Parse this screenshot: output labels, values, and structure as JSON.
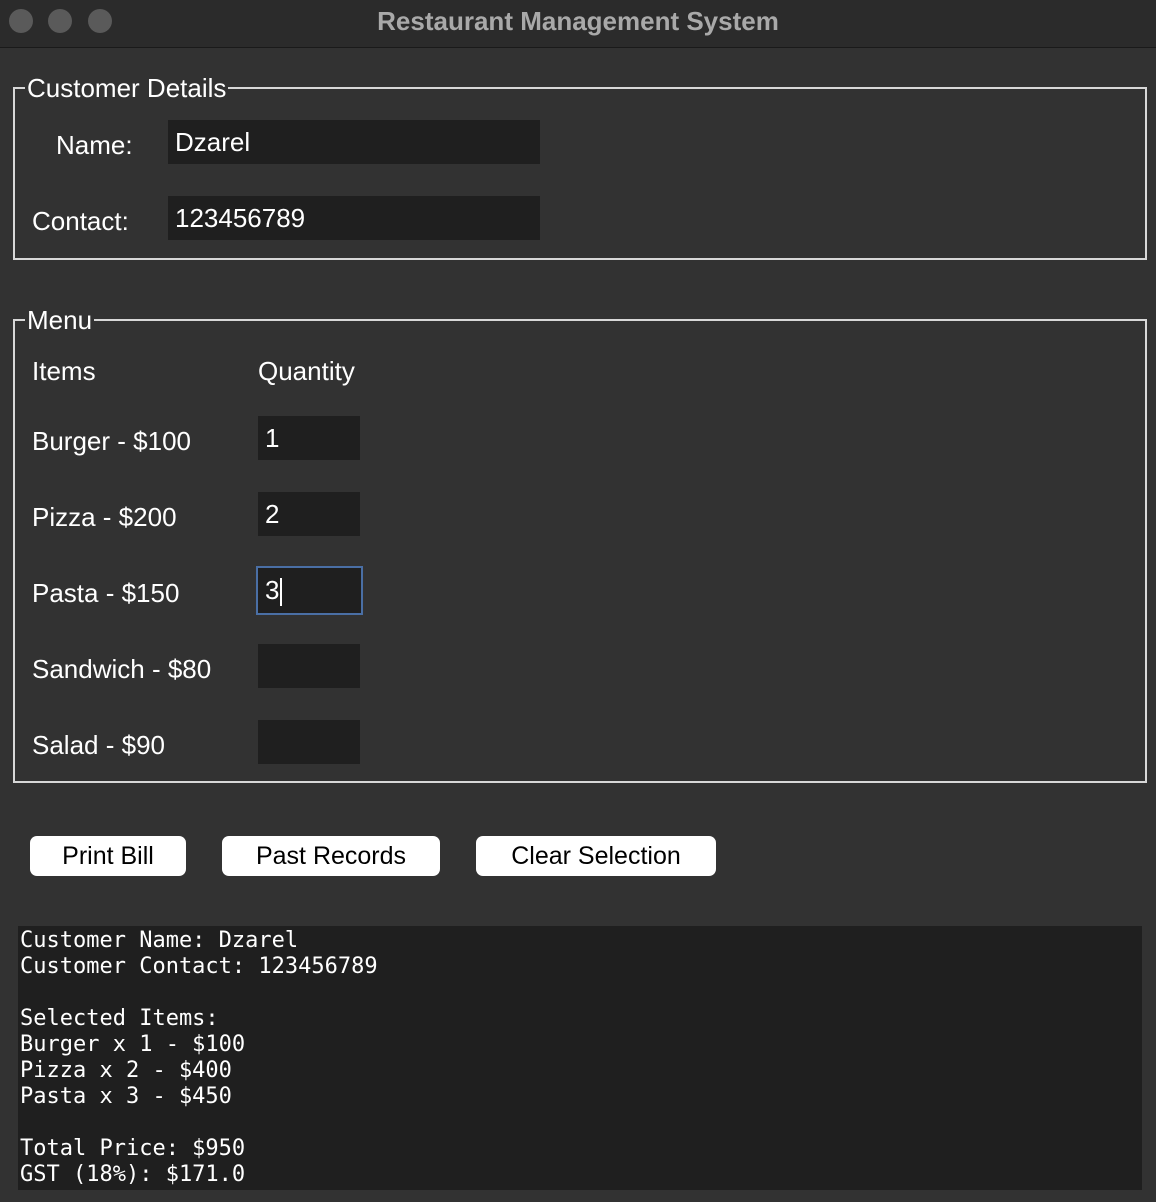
{
  "window": {
    "title": "Restaurant Management System"
  },
  "customer": {
    "legend": "Customer Details",
    "name_label": "Name:",
    "name_value": "Dzarel",
    "contact_label": "Contact:",
    "contact_value": "123456789"
  },
  "menu": {
    "legend": "Menu",
    "items_header": "Items",
    "quantity_header": "Quantity",
    "items": [
      {
        "label": "Burger - $100",
        "quantity": "1"
      },
      {
        "label": "Pizza - $200",
        "quantity": "2"
      },
      {
        "label": "Pasta - $150",
        "quantity": "3"
      },
      {
        "label": "Sandwich - $80",
        "quantity": ""
      },
      {
        "label": "Salad - $90",
        "quantity": ""
      }
    ]
  },
  "buttons": {
    "print_bill": "Print Bill",
    "past_records": "Past Records",
    "clear_selection": "Clear Selection"
  },
  "bill": {
    "lines": [
      "Customer Name: Dzarel",
      "Customer Contact: 123456789",
      "",
      "Selected Items:",
      "Burger x 1 - $100",
      "Pizza x 2 - $400",
      "Pasta x 3 - $450",
      "",
      "Total Price: $950",
      "GST (18%): $171.0"
    ]
  }
}
